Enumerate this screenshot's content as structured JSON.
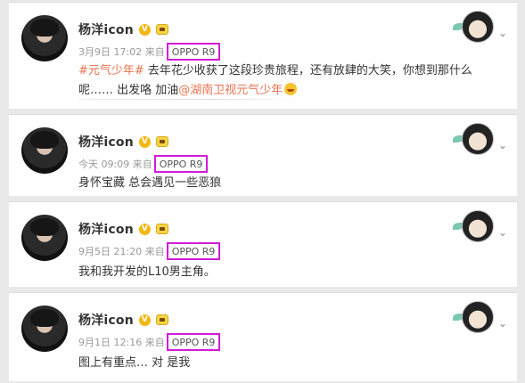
{
  "author": {
    "name": "杨洋icon",
    "verified_mark": "V"
  },
  "colors": {
    "highlight_box": "#d21bd8",
    "link": "#eb7350",
    "verified": "#f2b711"
  },
  "posts": [
    {
      "time": "3月9日 17:02",
      "via": "来自",
      "source": "OPPO R9",
      "text_line1_hashtag": "#元气少年#",
      "text_line1": " 去年花少收获了这段珍贵旅程，还有放肆的大笑，你想到那什么",
      "text_line2": "呢…… 出发咯 加油",
      "mention": "@湖南卫视元气少年"
    },
    {
      "time": "今天 09:09",
      "via": "来自",
      "source": "OPPO R9",
      "text_line1": "身怀宝藏 总会遇见一些恶狼"
    },
    {
      "time": "9月5日 21:20",
      "via": "来自",
      "source": "OPPO R9",
      "text_line1": "我和我开发的L10男主角。"
    },
    {
      "time": "9月1日 12:16",
      "via": "来自",
      "source": "OPPO R9",
      "text_line1": "图上有重点… 对 是我"
    }
  ]
}
